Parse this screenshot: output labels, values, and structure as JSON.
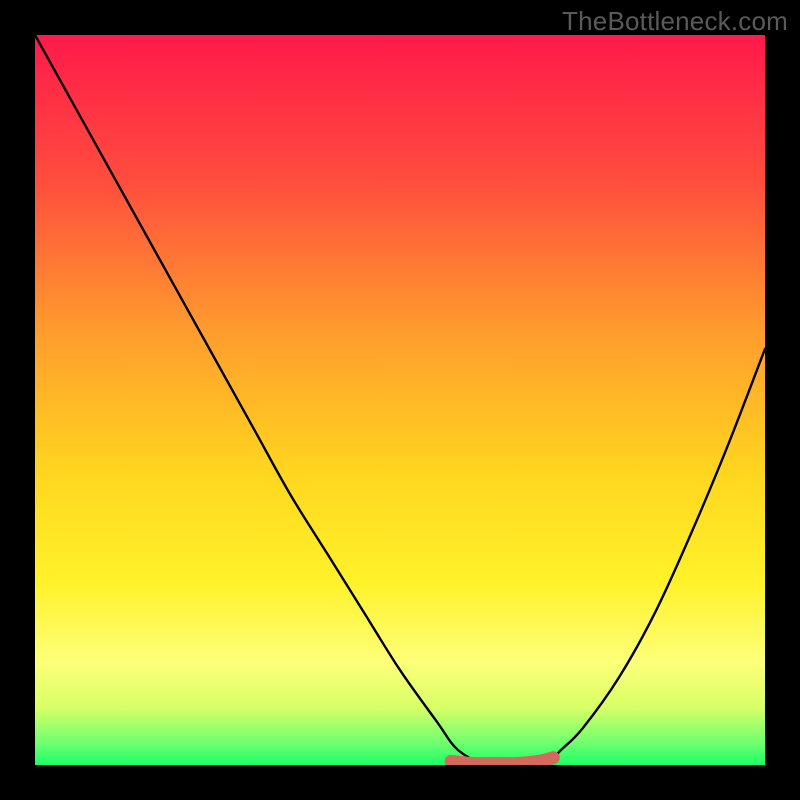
{
  "watermark": "TheBottleneck.com",
  "chart_data": {
    "type": "line",
    "title": "",
    "xlabel": "",
    "ylabel": "",
    "xlim": [
      0,
      100
    ],
    "ylim": [
      0,
      100
    ],
    "grid": false,
    "legend": false,
    "series": [
      {
        "name": "bottleneck-curve",
        "x": [
          0,
          5,
          10,
          15,
          20,
          25,
          30,
          35,
          40,
          45,
          50,
          55,
          58,
          62,
          65,
          68,
          70,
          72,
          75,
          80,
          85,
          90,
          95,
          100
        ],
        "values": [
          100,
          91,
          82,
          73,
          64,
          55,
          46,
          37,
          29,
          21,
          13,
          6,
          2,
          0,
          0,
          0,
          0,
          2,
          5,
          12,
          21,
          32,
          44,
          57
        ]
      },
      {
        "name": "optimal-band",
        "x": [
          57,
          60,
          63,
          66,
          69,
          71
        ],
        "values": [
          0.5,
          0.2,
          0.2,
          0.2,
          0.5,
          1.0
        ]
      }
    ],
    "gradient_stops": [
      {
        "offset": 0.0,
        "color": "#ff1a4b"
      },
      {
        "offset": 0.2,
        "color": "#ff4d3d"
      },
      {
        "offset": 0.4,
        "color": "#ff9a2e"
      },
      {
        "offset": 0.6,
        "color": "#ffd61f"
      },
      {
        "offset": 0.75,
        "color": "#fff22a"
      },
      {
        "offset": 0.86,
        "color": "#fdff7a"
      },
      {
        "offset": 0.92,
        "color": "#d9ff66"
      },
      {
        "offset": 0.97,
        "color": "#6fff6f"
      },
      {
        "offset": 1.0,
        "color": "#1aff66"
      }
    ],
    "optimal_band_color": "#d46a5c",
    "curve_color": "#000000"
  }
}
